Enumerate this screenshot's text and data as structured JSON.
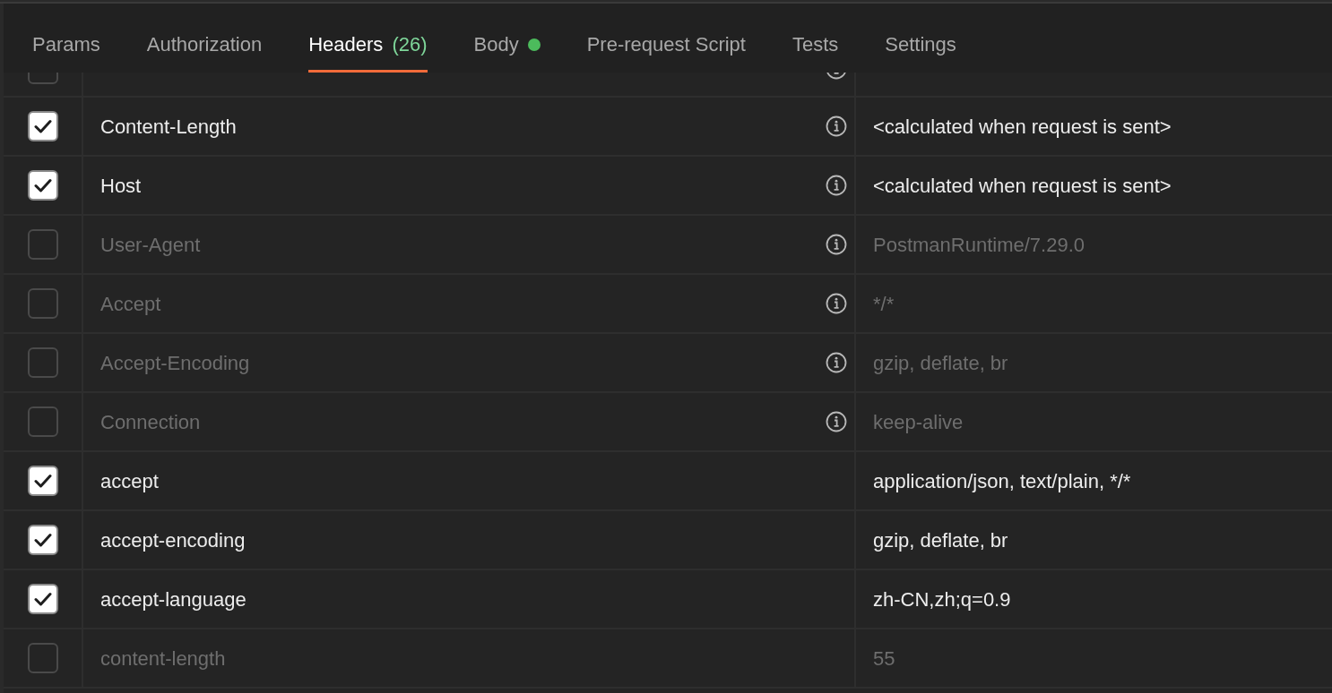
{
  "tabs": [
    {
      "label": "Params",
      "selected": false,
      "dot": false
    },
    {
      "label": "Authorization",
      "selected": false,
      "dot": false
    },
    {
      "label": "Headers",
      "count": "(26)",
      "selected": true,
      "dot": false
    },
    {
      "label": "Body",
      "selected": false,
      "dot": true
    },
    {
      "label": "Pre-request Script",
      "selected": false,
      "dot": false
    },
    {
      "label": "Tests",
      "selected": false,
      "dot": false
    },
    {
      "label": "Settings",
      "selected": false,
      "dot": false
    }
  ],
  "headers_table": {
    "clipped_row": {
      "enabled": false,
      "info": true
    },
    "rows": [
      {
        "enabled": true,
        "key": "Content-Length",
        "info": true,
        "value": "<calculated when request is sent>"
      },
      {
        "enabled": true,
        "key": "Host",
        "info": true,
        "value": "<calculated when request is sent>"
      },
      {
        "enabled": false,
        "key": "User-Agent",
        "info": true,
        "value": "PostmanRuntime/7.29.0"
      },
      {
        "enabled": false,
        "key": "Accept",
        "info": true,
        "value": "*/*"
      },
      {
        "enabled": false,
        "key": "Accept-Encoding",
        "info": true,
        "value": "gzip, deflate, br"
      },
      {
        "enabled": false,
        "key": "Connection",
        "info": true,
        "value": "keep-alive"
      },
      {
        "enabled": true,
        "key": "accept",
        "info": false,
        "value": "application/json, text/plain, */*"
      },
      {
        "enabled": true,
        "key": "accept-encoding",
        "info": false,
        "value": "gzip, deflate, br"
      },
      {
        "enabled": true,
        "key": "accept-language",
        "info": false,
        "value": "zh-CN,zh;q=0.9"
      },
      {
        "enabled": false,
        "key": "content-length",
        "info": false,
        "value": "55"
      }
    ]
  }
}
